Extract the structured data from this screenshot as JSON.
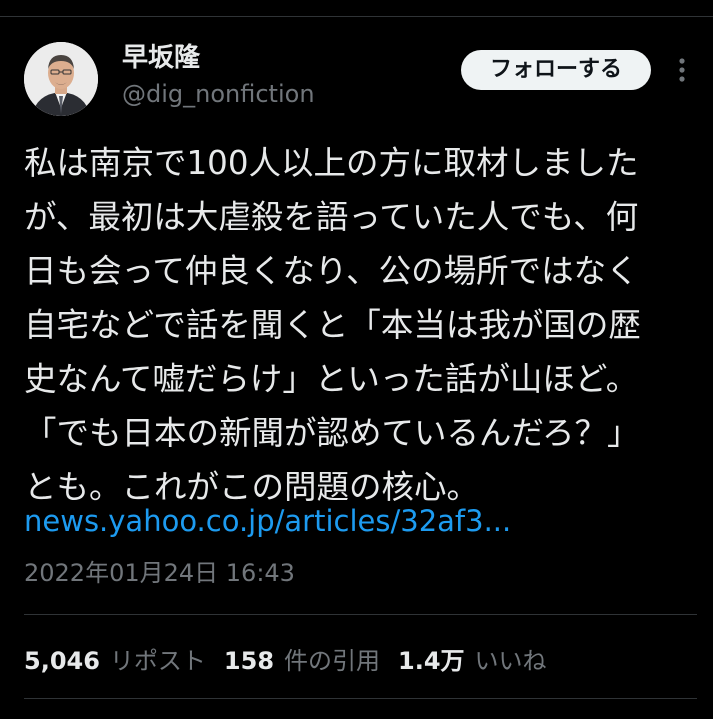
{
  "author": {
    "display_name": "早坂隆",
    "handle": "@dig_nonfiction",
    "follow_label": "フォローする"
  },
  "tweet": {
    "lines": [
      "私は南京で100人以上の方に取材しました",
      "が、最初は大虐殺を語っていた人でも、何",
      "日も会って仲良くなり、公の場所ではなく",
      "自宅などで話を聞くと「本当は我が国の歴",
      "史なんて嘘だらけ」といった話が山ほど。",
      "「でも日本の新聞が認めているんだろ？」",
      "とも。これがこの問題の核心。"
    ],
    "link": "news.yahoo.co.jp/articles/32af3...",
    "timestamp": "2022年01月24日 16:43"
  },
  "stats": {
    "reposts_count": "5,046",
    "reposts_label": "リポスト",
    "quotes_count": "158",
    "quotes_label": "件の引用",
    "likes_count": "1.4万",
    "likes_label": "いいね"
  },
  "icons": {
    "more": "more-vertical-icon"
  },
  "colors": {
    "background": "#000000",
    "text": "#e7e9ea",
    "secondary": "#71767b",
    "link": "#1d9bf0",
    "follow_button_bg": "#eff3f4",
    "divider": "#2f3336"
  }
}
